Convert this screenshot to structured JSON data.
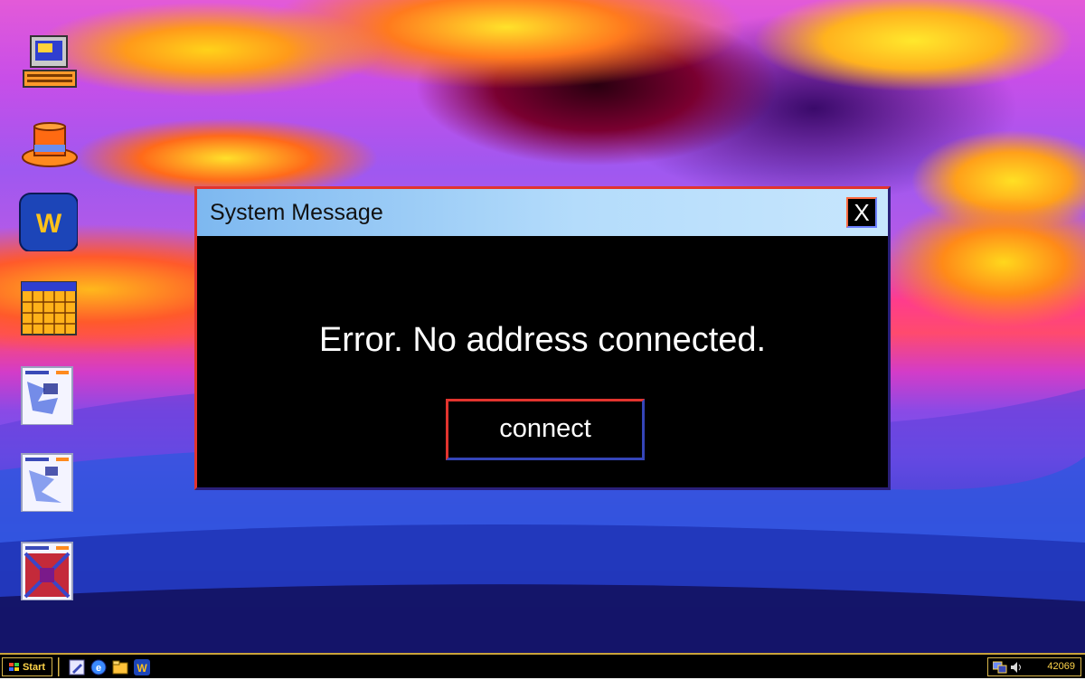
{
  "dialog": {
    "title": "System Message",
    "close_label": "X",
    "message": "Error. No address connected.",
    "connect_label": "connect"
  },
  "taskbar": {
    "start_label": "Start",
    "clock": "42069"
  },
  "desktop_icons": [
    "computer-icon",
    "hat-icon",
    "w-app-icon",
    "calendar-icon",
    "document-thumbnail-icon",
    "document-thumbnail-icon",
    "red-document-thumbnail-icon"
  ],
  "colors": {
    "title_bar": "#b4dcfb",
    "dialog_bg": "#000000",
    "border_light": "#e2342e",
    "border_dark": "#2a1f7a",
    "taskbar_accent": "#d9b64a"
  }
}
